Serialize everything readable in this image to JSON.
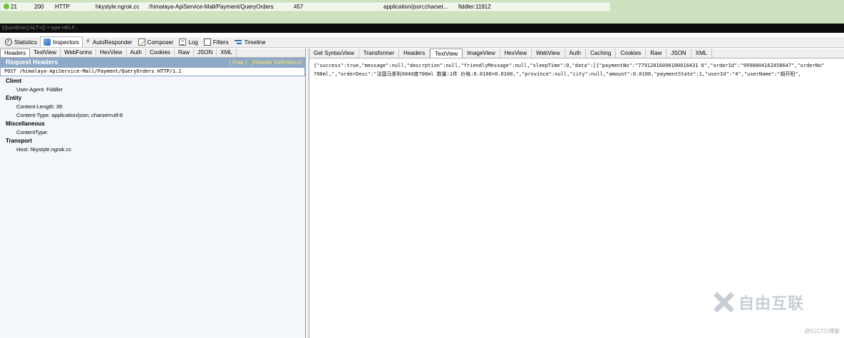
{
  "session": {
    "row": {
      "num": "21",
      "result": "200",
      "protocol": "HTTP",
      "host": "hkystyle.ngrok.cc",
      "url": "/himalaya-ApiService-Mall/Payment/QueryOrders",
      "body": "457",
      "content_type": "application/json;charset...",
      "process": "fiddler:11912"
    }
  },
  "quickexec": {
    "placeholder": "[QuickExec] ALT+Q > type HELP..."
  },
  "main_tabs": [
    {
      "label": "Statistics",
      "icon": "stats-icon"
    },
    {
      "label": "Inspectors",
      "icon": "inspectors-icon"
    },
    {
      "label": "AutoResponder",
      "icon": "lightning-icon"
    },
    {
      "label": "Composer",
      "icon": "compose-icon"
    },
    {
      "label": "Log",
      "icon": "log-icon"
    },
    {
      "label": "Filters",
      "icon": "checkbox-icon"
    },
    {
      "label": "Timeline",
      "icon": "timeline-icon"
    }
  ],
  "request": {
    "tabs": [
      "Headers",
      "TextView",
      "WebForms",
      "HexView",
      "Auth",
      "Cookies",
      "Raw",
      "JSON",
      "XML"
    ],
    "title": "Request Headers",
    "raw_link": "[ Raw ]",
    "defs_link": "[Header Definitions]",
    "request_line": "POST /himalaya-ApiService-Mall/Payment/QueryOrders HTTP/1.1",
    "groups": [
      {
        "name": "Client",
        "items": [
          "User-Agent: Fiddler"
        ]
      },
      {
        "name": "Entity",
        "items": [
          "Content-Length: 39",
          "Content-Type: application/json; charset=utf-8"
        ]
      },
      {
        "name": "Miscellaneous",
        "items": [
          "ContentType:"
        ]
      },
      {
        "name": "Transport",
        "items": [
          "Host: hkystyle.ngrok.cc"
        ]
      }
    ]
  },
  "response": {
    "tabs": [
      "Get SyntaxView",
      "Transformer",
      "Headers",
      "TextView",
      "ImageView",
      "HexView",
      "WebView",
      "Auth",
      "Caching",
      "Cookies",
      "Raw",
      "JSON",
      "XML"
    ],
    "active_tab": "TextView",
    "body_lines": [
      "{\"success\":true,\"message\":null,\"descrption\":null,\"friendlyMessage\":null,\"sleepTime\":0,\"data\":[{\"paymentNo\":\"77912016090100016431 6\",\"orderId\":\"9990004162458647\",\"orderNo\"",
      "700ml,\",\"orderDesc\":\"法国马爹利X040度700ml 数量:1件 价格:0.0100=0.0100,\",\"province\":null,\"city\":null,\"amount\":0.0100,\"paymentState\":1,\"userId\":\"4\",\"userName\":\"胡开阳\","
    ]
  },
  "watermark": {
    "brand": "自由互联",
    "site": "@51CTO博客"
  }
}
